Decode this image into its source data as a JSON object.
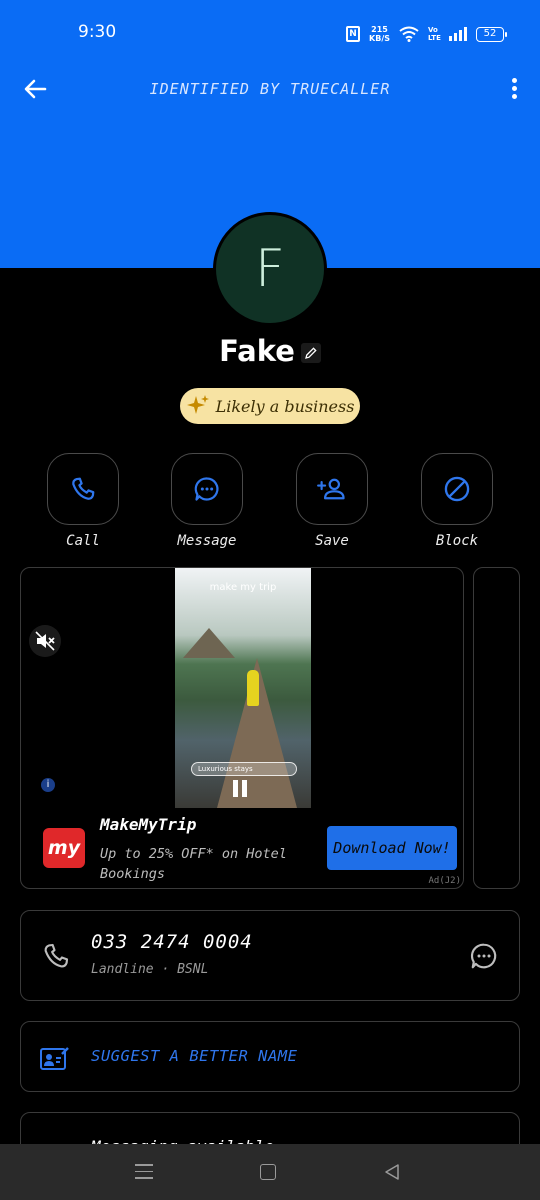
{
  "status_bar": {
    "time": "9:30",
    "speed_value": "215",
    "speed_unit": "KB/S",
    "network_tag": "Vo LTE",
    "battery": "52",
    "icons": [
      "nfc-icon",
      "wifi-icon",
      "signal-icon",
      "battery-icon"
    ]
  },
  "header": {
    "title": "IDENTIFIED BY TRUECALLER",
    "back_icon": "arrow-left-icon",
    "more_icon": "more-vertical-icon",
    "color": "#0a6cf5"
  },
  "contact": {
    "initial": "F",
    "name": "Fake",
    "badge": "Likely a business",
    "avatar_color": "#103225"
  },
  "actions": [
    {
      "label": "Call",
      "icon": "phone-icon"
    },
    {
      "label": "Message",
      "icon": "chat-bubble-icon"
    },
    {
      "label": "Save",
      "icon": "add-person-icon"
    },
    {
      "label": "Block",
      "icon": "block-icon"
    }
  ],
  "ad": {
    "video_brand": "make my trip",
    "video_search": "Luxurious stays",
    "logo_text": "my",
    "title": "MakeMyTrip",
    "description": "Up to 25% OFF* on Hotel Bookings",
    "cta": "Download Now!",
    "tag": "Ad(J2)",
    "accent": "#1f6fe8"
  },
  "phone": {
    "number": "033 2474 0004",
    "meta": "Landline · BSNL"
  },
  "suggest": {
    "label": "SUGGEST A BETTER NAME"
  },
  "partial": {
    "text": "Messaging available"
  }
}
